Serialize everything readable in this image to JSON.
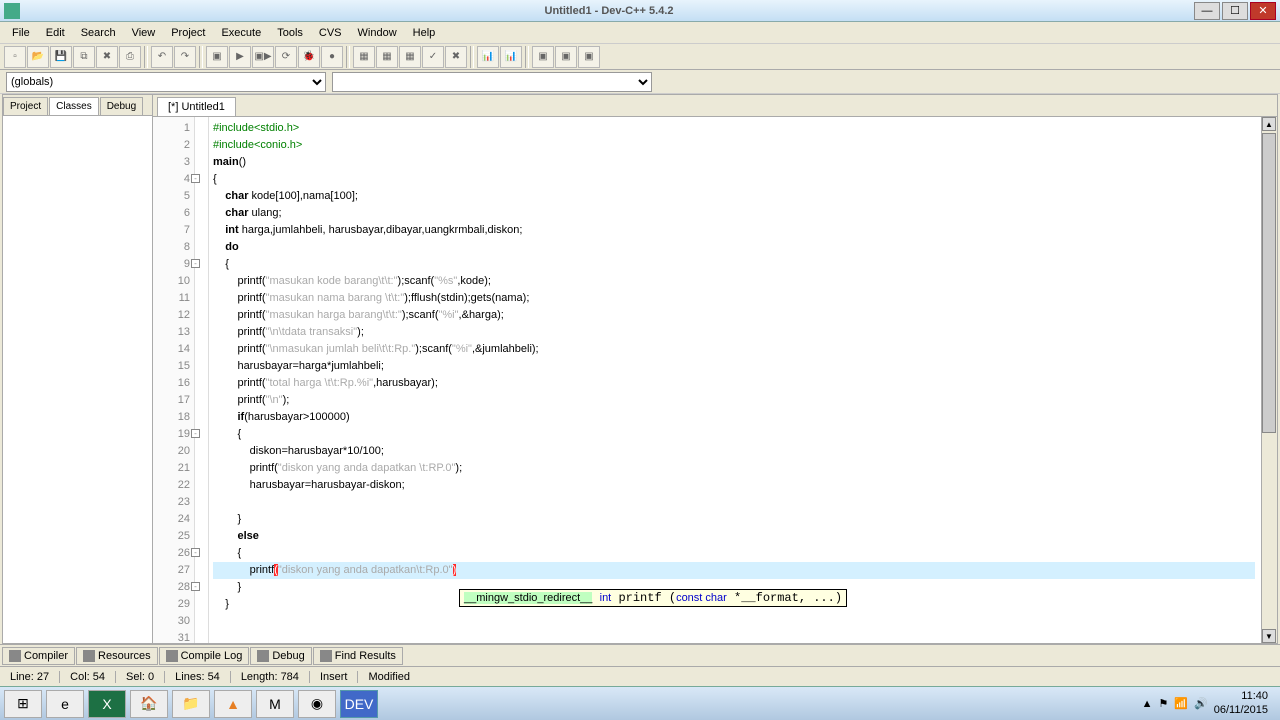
{
  "window": {
    "title": "Untitled1 - Dev-C++ 5.4.2"
  },
  "menu": [
    "File",
    "Edit",
    "Search",
    "View",
    "Project",
    "Execute",
    "Tools",
    "CVS",
    "Window",
    "Help"
  ],
  "combos": {
    "scope": "(globals)",
    "member": ""
  },
  "leftTabs": [
    "Project",
    "Classes",
    "Debug"
  ],
  "leftActive": 1,
  "editorTabs": [
    "[*] Untitled1"
  ],
  "code": {
    "firstLine": 1,
    "lines": [
      {
        "n": 1,
        "pre": "#include<stdio.h>"
      },
      {
        "n": 2,
        "pre": "#include<conio.h>"
      },
      {
        "n": 3,
        "txt": "main()"
      },
      {
        "n": 4,
        "fold": true,
        "txt": "{"
      },
      {
        "n": 5,
        "txt": "    char kode[100],nama[100];"
      },
      {
        "n": 6,
        "txt": "    char ulang;"
      },
      {
        "n": 7,
        "txt": "    int harga,jumlahbeli, harusbayar,dibayar,uangkrmbali,diskon;"
      },
      {
        "n": 8,
        "txt": "    do"
      },
      {
        "n": 9,
        "fold": true,
        "txt": "    {"
      },
      {
        "n": 10,
        "txt": "        printf(\"masukan kode barang\\t\\t:\");scanf(\"%s\",kode);"
      },
      {
        "n": 11,
        "txt": "        printf(\"masukan nama barang \\t\\t:\");fflush(stdin);gets(nama);"
      },
      {
        "n": 12,
        "txt": "        printf(\"masukan harga barang\\t\\t:\");scanf(\"%i\",&harga);"
      },
      {
        "n": 13,
        "txt": "        printf(\"\\n\\tdata transaksi\");"
      },
      {
        "n": 14,
        "txt": "        printf(\"\\nmasukan jumlah beli\\t\\t:Rp.\");scanf(\"%i\",&jumlahbeli);"
      },
      {
        "n": 15,
        "txt": "        harusbayar=harga*jumlahbeli;"
      },
      {
        "n": 16,
        "txt": "        printf(\"total harga \\t\\t:Rp.%i\",harusbayar);"
      },
      {
        "n": 17,
        "txt": "        printf(\"\\n\");"
      },
      {
        "n": 18,
        "txt": "        if(harusbayar>100000)"
      },
      {
        "n": 19,
        "fold": true,
        "txt": "        {"
      },
      {
        "n": 20,
        "txt": "            diskon=harusbayar*10/100;"
      },
      {
        "n": 21,
        "txt": "            printf(\"diskon yang anda dapatkan \\t:RP.0\");"
      },
      {
        "n": 22,
        "txt": "            harusbayar=harusbayar-diskon;"
      },
      {
        "n": 23,
        "txt": ""
      },
      {
        "n": 24,
        "txt": "        }"
      },
      {
        "n": 25,
        "txt": "        else"
      },
      {
        "n": 26,
        "fold": true,
        "txt": "        {"
      },
      {
        "n": 27,
        "hl": true,
        "txt": "            printf(\"diskon yang anda dapatkan\\t:Rp.0\")"
      },
      {
        "n": 28,
        "fold": true,
        "txt": "        }"
      },
      {
        "n": 29,
        "txt": "    }"
      },
      {
        "n": 30,
        "txt": ""
      },
      {
        "n": 31,
        "txt": ""
      }
    ]
  },
  "tooltip": {
    "text": "__mingw_stdio_redirect__ int printf (const char *__format, ...)"
  },
  "bottomTabs": [
    "Compiler",
    "Resources",
    "Compile Log",
    "Debug",
    "Find Results"
  ],
  "status": {
    "line": "Line:   27",
    "col": "Col:   54",
    "sel": "Sel:   0",
    "lines": "Lines:   54",
    "length": "Length:   784",
    "mode": "Insert",
    "modified": "Modified"
  },
  "taskbar": {
    "clock": {
      "time": "11:40",
      "date": "06/11/2015"
    }
  }
}
